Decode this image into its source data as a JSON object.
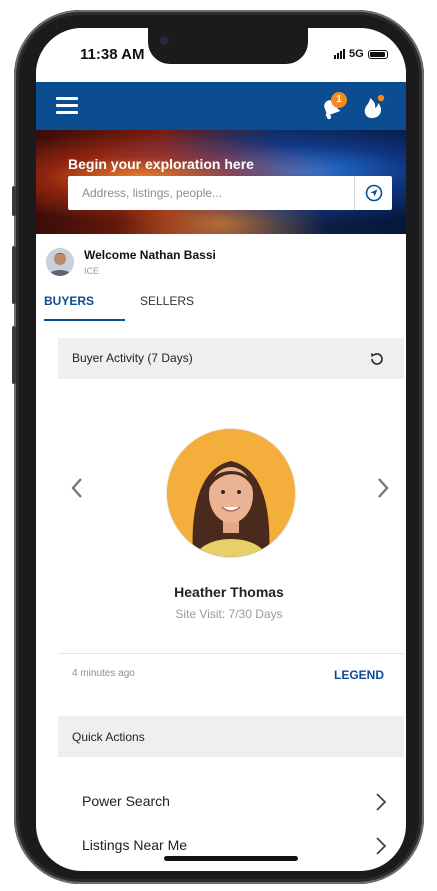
{
  "status_bar": {
    "time": "11:38 AM",
    "network": "5G"
  },
  "app_bar": {
    "notification_count": "1"
  },
  "hero": {
    "title": "Begin your exploration here",
    "search_placeholder": "Address, listings, people..."
  },
  "welcome": {
    "name": "Welcome Nathan Bassi",
    "org": "ICE"
  },
  "tabs": [
    {
      "label": "BUYERS",
      "active": true
    },
    {
      "label": "SELLERS",
      "active": false
    }
  ],
  "buyer_activity": {
    "title": "Buyer Activity (7 Days)",
    "profile_name": "Heather Thomas",
    "profile_sub": "Site Visit: 7/30 Days",
    "time_ago": "4 minutes ago",
    "legend_label": "LEGEND"
  },
  "quick_actions": {
    "title": "Quick Actions",
    "items": [
      {
        "label": "Power Search"
      },
      {
        "label": "Listings Near Me"
      }
    ]
  },
  "colors": {
    "brand_blue": "#0c4c90",
    "badge_orange": "#f28a1f",
    "section_gray": "#efefef"
  },
  "icons": [
    "menu-icon",
    "bell-icon",
    "flame-icon",
    "location-icon",
    "refresh-icon",
    "chevron-left-icon",
    "chevron-right-icon"
  ]
}
